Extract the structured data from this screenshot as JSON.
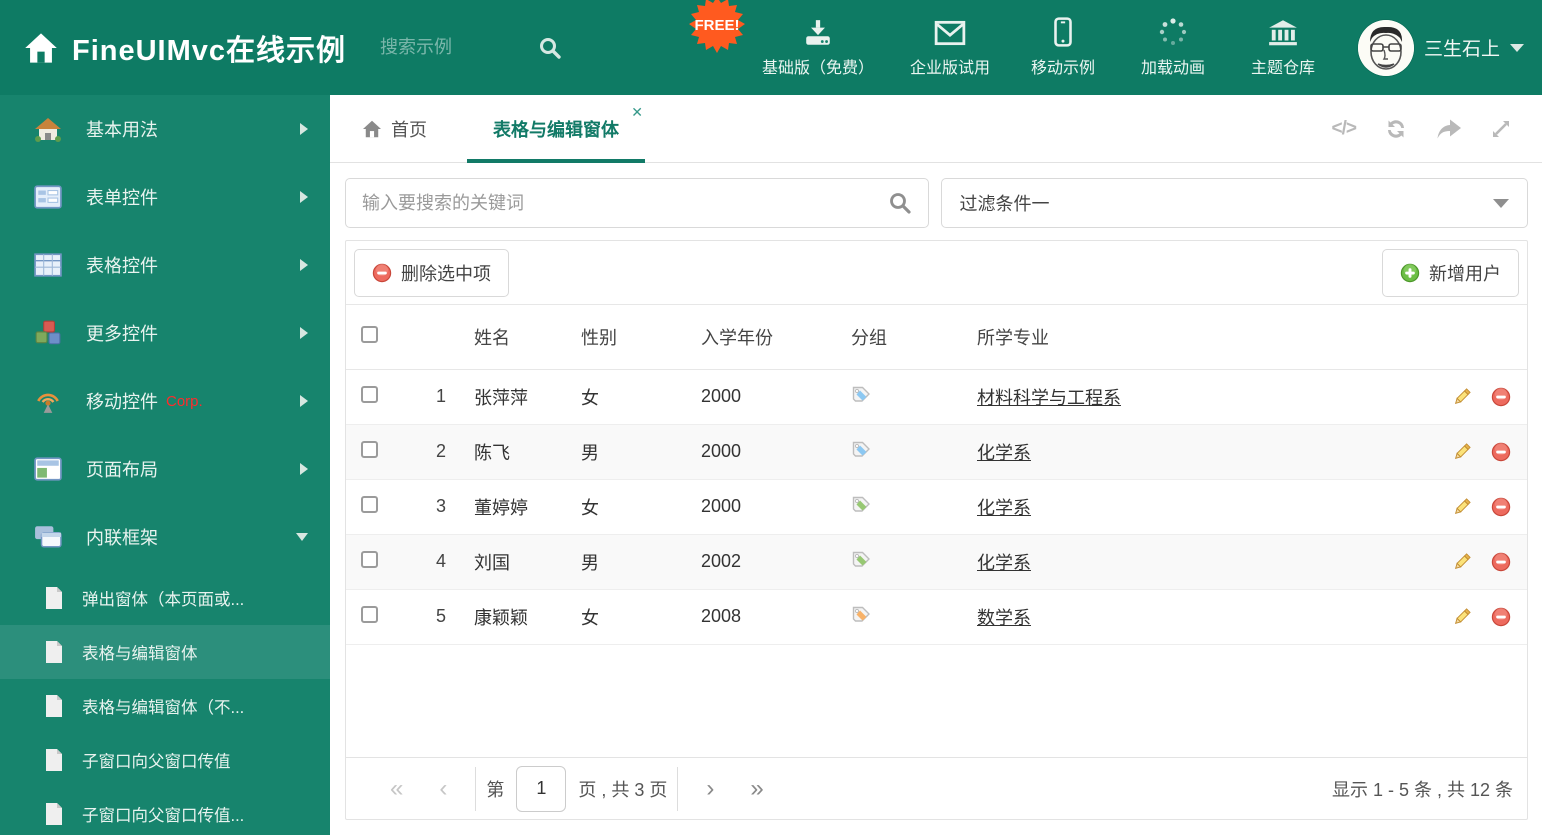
{
  "colors": {
    "accent": "#0E7B64",
    "sidebar": "#17846D",
    "sidebar_selected": "#2C8F7C",
    "tab_active": "#127A67",
    "free": "#FF5A1F",
    "delete_red": "#E45F51",
    "add_green": "#6CBE45"
  },
  "header": {
    "title": "FineUIMvc在线示例",
    "search_placeholder": "搜索示例",
    "free_badge": "FREE!",
    "nav": [
      {
        "label": "基础版（免费）",
        "icon": "download-icon"
      },
      {
        "label": "企业版试用",
        "icon": "envelope-icon"
      },
      {
        "label": "移动示例",
        "icon": "mobile-icon"
      },
      {
        "label": "加载动画",
        "icon": "spinner-icon"
      },
      {
        "label": "主题仓库",
        "icon": "bank-icon"
      }
    ],
    "user": {
      "name": "三生石上"
    }
  },
  "sidebar": {
    "items": [
      {
        "label": "基本用法"
      },
      {
        "label": "表单控件"
      },
      {
        "label": "表格控件"
      },
      {
        "label": "更多控件"
      },
      {
        "label": "移动控件",
        "badge": "Corp."
      },
      {
        "label": "页面布局"
      },
      {
        "label": "内联框架"
      }
    ],
    "subitems": [
      {
        "label": "弹出窗体（本页面或..."
      },
      {
        "label": "表格与编辑窗体"
      },
      {
        "label": "表格与编辑窗体（不..."
      },
      {
        "label": "子窗口向父窗口传值"
      },
      {
        "label": "子窗口向父窗口传值..."
      }
    ]
  },
  "tabs": {
    "home": "首页",
    "active": "表格与编辑窗体",
    "close_glyph": "✕"
  },
  "content": {
    "keyword_placeholder": "输入要搜索的关键词",
    "filter_value": "过滤条件一",
    "delete_button": "删除选中项",
    "add_button": "新增用户"
  },
  "table": {
    "headers": {
      "name": "姓名",
      "gender": "性别",
      "year": "入学年份",
      "group": "分组",
      "major": "所学专业"
    },
    "rows": [
      {
        "index": "1",
        "name": "张萍萍",
        "gender": "女",
        "year": "2000",
        "tag_color": "#8CC8F2",
        "major": "材料科学与工程系"
      },
      {
        "index": "2",
        "name": "陈飞",
        "gender": "男",
        "year": "2000",
        "tag_color": "#8CC8F2",
        "major": "化学系"
      },
      {
        "index": "3",
        "name": "董婷婷",
        "gender": "女",
        "year": "2000",
        "tag_color": "#97C873",
        "major": "化学系"
      },
      {
        "index": "4",
        "name": "刘国",
        "gender": "男",
        "year": "2002",
        "tag_color": "#97C873",
        "major": "化学系"
      },
      {
        "index": "5",
        "name": "康颖颖",
        "gender": "女",
        "year": "2008",
        "tag_color": "#F8B268",
        "major": "数学系"
      }
    ]
  },
  "pagination": {
    "icons": {
      "first": "«",
      "prev": "‹",
      "next": "›",
      "last": "»"
    },
    "page_prefix": "第",
    "page_value": "1",
    "page_suffix": "页 , 共 3 页",
    "summary": "显示 1 - 5 条 , 共 12 条"
  }
}
